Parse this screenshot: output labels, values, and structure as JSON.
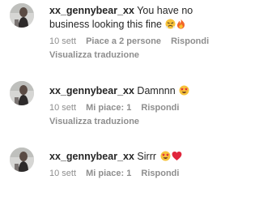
{
  "comments": [
    {
      "username": "xx_gennybear_xx",
      "text": "You have no business looking this fine",
      "emojis": [
        "face-with-steam-icon",
        "fire-icon"
      ],
      "time": "10 sett",
      "likes": "Piace a 2 persone",
      "reply": "Rispondi",
      "translate": "Visualizza traduzione"
    },
    {
      "username": "xx_gennybear_xx",
      "text": "Damnnn",
      "emojis": [
        "star-struck-face-icon"
      ],
      "time": "10 sett",
      "likes": "Mi piace: 1",
      "reply": "Rispondi",
      "translate": "Visualizza traduzione"
    },
    {
      "username": "xx_gennybear_xx",
      "text": "Sirrr",
      "emojis": [
        "star-struck-face-icon",
        "red-heart-icon"
      ],
      "time": "10 sett",
      "likes": "Mi piace: 1",
      "reply": "Rispondi"
    }
  ],
  "colors": {
    "text": "#262626",
    "secondary": "#8e8e8e",
    "heart": "#e0263c",
    "emoji_face": "#f7c33b"
  }
}
